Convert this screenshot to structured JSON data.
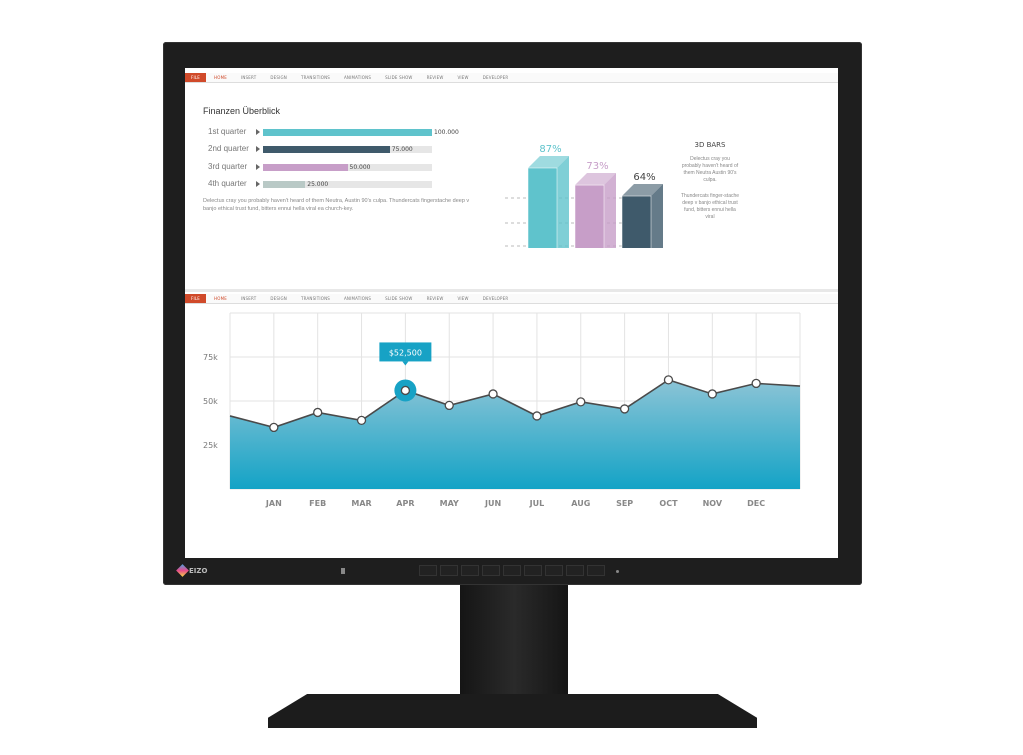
{
  "monitor": {
    "brand": "EIZO"
  },
  "ribbon": {
    "tabs": [
      "FILE",
      "HOME",
      "INSERT",
      "DESIGN",
      "TRANSITIONS",
      "ANIMATIONS",
      "SLIDE SHOW",
      "REVIEW",
      "VIEW",
      "DEVELOPER"
    ]
  },
  "slide1": {
    "title": "Finanzen Überblick",
    "bars": [
      {
        "label": "1st quarter",
        "value": "100.000",
        "fraction": 1.0,
        "color": "#5fc3cc"
      },
      {
        "label": "2nd quarter",
        "value": "75.000",
        "fraction": 0.75,
        "color": "#3f5a6b"
      },
      {
        "label": "3rd quarter",
        "value": "50.000",
        "fraction": 0.5,
        "color": "#c79ec8"
      },
      {
        "label": "4th quarter",
        "value": "25.000",
        "fraction": 0.25,
        "color": "#b9c9c6"
      }
    ],
    "description": "Delectus cray you probably haven't heard of them Neutra, Austin 90's culpa. Thundercats fingerstache deep v banjo ethical trust fund, bitters ennui hella viral ea church-key.",
    "bars3d": [
      {
        "label": "87%",
        "value": 87,
        "color": "#5fc3cc"
      },
      {
        "label": "73%",
        "value": 73,
        "color": "#c79ec8"
      },
      {
        "label": "64%",
        "value": 64,
        "color": "#3f5a6b"
      }
    ],
    "side_title": "3D BARS",
    "side_text1": "Delectus cray you probably haven't heard of them Neutra Austin 90's culpa.",
    "side_text2": "Thundercats finger-stache deep v banjo ethical trust fund, bitters ennui hella viral"
  },
  "chart_data": {
    "type": "area",
    "categories": [
      "JAN",
      "FEB",
      "MAR",
      "APR",
      "MAY",
      "JUN",
      "JUL",
      "AUG",
      "SEP",
      "OCT",
      "NOV",
      "DEC"
    ],
    "values": [
      35,
      43.5,
      39,
      56,
      47.5,
      54,
      41.5,
      49.5,
      45.5,
      62,
      54,
      60
    ],
    "start_value": 41.5,
    "end_value": 58.5,
    "yticks": [
      "25k",
      "50k",
      "75k"
    ],
    "ylim": [
      0,
      100
    ],
    "tooltip": {
      "category": "APR",
      "label": "$52,500"
    },
    "grid": true,
    "colors": {
      "fill_top": "#8cc4d6",
      "fill_bottom": "#13a3c6",
      "line": "#4a4a4a",
      "tooltip": "#17a2c5"
    }
  }
}
